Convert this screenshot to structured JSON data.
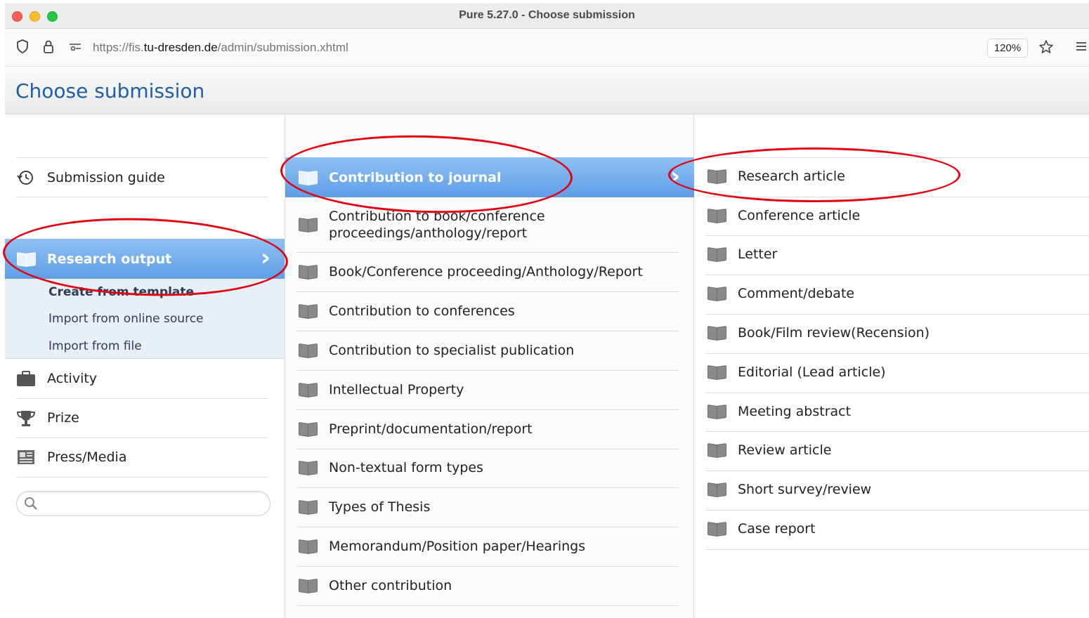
{
  "window": {
    "title": "Pure 5.27.0 - Choose submission"
  },
  "browser": {
    "url_prefix": "https://fis.",
    "url_host": "tu-dresden.de",
    "url_path": "/admin/submission.xhtml",
    "zoom": "120%"
  },
  "page": {
    "title": "Choose submission"
  },
  "left_nav": {
    "submission_guide": "Submission guide",
    "research_output": "Research output",
    "sub_items": [
      "Create from template",
      "Import from online source",
      "Import from file"
    ],
    "items": [
      "Activity",
      "Prize",
      "Press/Media"
    ],
    "search_placeholder": ""
  },
  "middle_list": {
    "selected": "Contribution to journal",
    "items": [
      "Contribution to book/conference proceedings/anthology/report",
      "Book/Conference proceeding/Anthology/Report",
      "Contribution to conferences",
      "Contribution to specialist publication",
      "Intellectual Property",
      "Preprint/documentation/report",
      "Non-textual form types",
      "Types of Thesis",
      "Memorandum/Position paper/Hearings",
      "Other contribution"
    ]
  },
  "right_list": {
    "items": [
      "Research article",
      "Conference article",
      "Letter",
      "Comment/debate",
      "Book/Film review(Recension)",
      "Editorial (Lead article)",
      "Meeting abstract",
      "Review article",
      "Short survey/review",
      "Case report"
    ]
  },
  "icons": {
    "nav": "book-icon",
    "guide": "history-icon",
    "activity": "briefcase-icon",
    "prize": "trophy-icon",
    "press": "newspaper-icon"
  },
  "colors": {
    "selected_bg": "#6aa7ea",
    "title": "#1d5fa8",
    "annotation": "#e3000f"
  }
}
